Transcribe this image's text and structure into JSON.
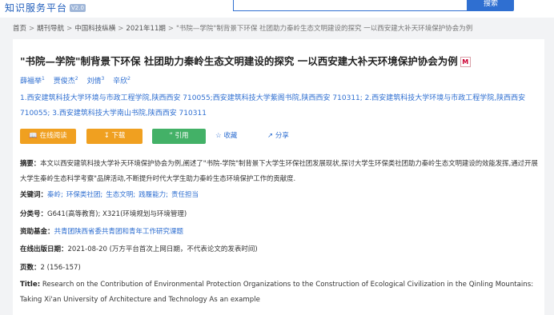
{
  "header": {
    "brand": "知识服务平台",
    "version": "V2.0",
    "search_button": "搜索"
  },
  "breadcrumb": {
    "items": [
      "首页",
      "期刊导航",
      "中国科技纵横",
      "2021年11期"
    ],
    "current": "\"书院—学院\"制背景下环保 社团助力秦岭生态文明建设的探究 一以西安建大补天环境保护协会为例"
  },
  "article": {
    "title": "\"书院—学院\"制背景下环保 社团助力秦岭生态文明建设的探究 一以西安建大补天环境保护协会为例",
    "title_badge": "M",
    "authors": [
      {
        "name": "薛福举",
        "sup": "1"
      },
      {
        "name": "贾俊杰",
        "sup": "2"
      },
      {
        "name": "刘倩",
        "sup": "3"
      },
      {
        "name": "辛欣",
        "sup": "2"
      }
    ],
    "affiliations": "1.西安建筑科技大学环境与市政工程学院,陕西西安 710055;西安建筑科技大学紫阁书院,陕西西安 710311; 2.西安建筑科技大学环境与市政工程学院,陕西西安 710055; 3.西安建筑科技大学南山书院,陕西西安 710311",
    "actions": {
      "read": "在线阅读",
      "download": "下载",
      "cite": "引用",
      "favorite": "收藏",
      "share": "分享"
    },
    "abstract_label": "摘要：",
    "abstract": "本文以西安建筑科技大学补天环境保护协会为例,阐述了\"书院-学院\"制背景下大学生环保社团发展现状,探讨大学生环保类社团助力秦岭生态文明建设的效能发挥,通过开展大学生秦岭生态科学考察\"品牌活动,不断提升时代大学生助力秦岭生态环境保护工作的贡献度.",
    "keywords_label": "关键词：",
    "keywords": [
      "秦岭;",
      "环保类社团;",
      "生态文明;",
      "践履能力;",
      "责任担当"
    ],
    "classification_label": "分类号：",
    "classification": "G641(高等教育); X321(环境规划与环境管理)",
    "fund_label": "资助基金：",
    "fund": "共青团陕西省委共青团和青年工作研究课题",
    "pubdate_label": "在线出版日期：",
    "pubdate": "2021-08-20  (万方平台首次上网日期，不代表论文的发表时间)",
    "pages_label": "页数：",
    "pages": "2 (156-157)",
    "en_title_label": "Title:",
    "en_title": "Research on the Contribution of Environmental Protection Organizations to the Construction of Ecological Civilization in the Qinling Mountains: Taking Xi'an University of Architecture and Technology As an example"
  }
}
